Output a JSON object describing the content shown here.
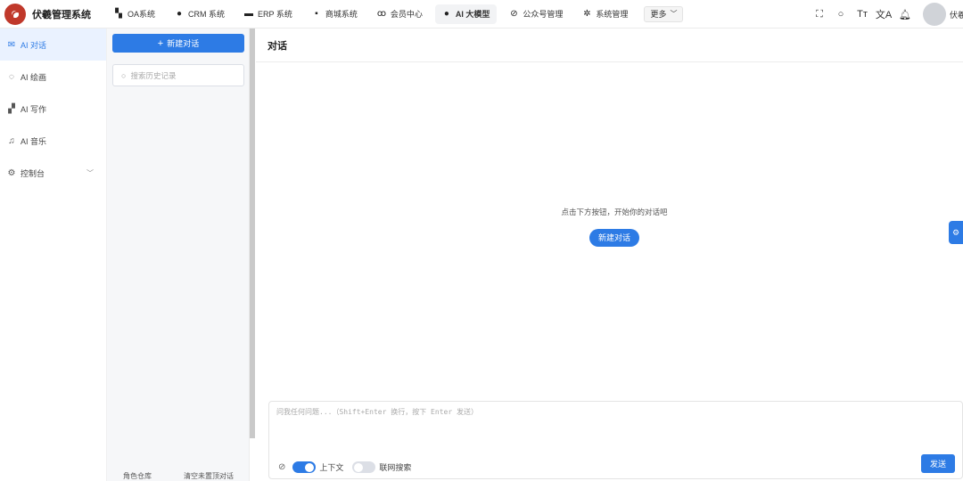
{
  "app": {
    "title": "伏羲管理系统"
  },
  "nav": {
    "items": [
      {
        "label": "OA系统",
        "icon": "oa-icon",
        "glyph": "▚"
      },
      {
        "label": "CRM 系统",
        "icon": "user-icon",
        "glyph": "●"
      },
      {
        "label": "ERP 系统",
        "icon": "erp-icon",
        "glyph": "▬"
      },
      {
        "label": "商城系统",
        "icon": "shop-icon",
        "glyph": "▪"
      },
      {
        "label": "会员中心",
        "icon": "bike-icon",
        "glyph": "ꝏ"
      },
      {
        "label": "AI 大模型",
        "icon": "apple-icon",
        "glyph": "●"
      },
      {
        "label": "公众号管理",
        "icon": "compass-icon",
        "glyph": "⊘"
      },
      {
        "label": "系统管理",
        "icon": "gear-icon",
        "glyph": "✲"
      }
    ],
    "active_index": 5,
    "more_label": "更多"
  },
  "header_tools": {
    "fullscreen": "⛶",
    "search": "○",
    "font_size": "Tт",
    "translate": "文A",
    "bell": "♫",
    "username": "伏羲"
  },
  "sidebar": {
    "items": [
      {
        "label": "AI 对话",
        "icon": "mail-icon",
        "glyph": "✉",
        "active": true
      },
      {
        "label": "AI 绘画",
        "icon": "palette-icon",
        "glyph": "◌"
      },
      {
        "label": "AI 写作",
        "icon": "writing-icon",
        "glyph": "▞"
      },
      {
        "label": "AI 音乐",
        "icon": "music-icon",
        "glyph": "♫"
      },
      {
        "label": "控制台",
        "icon": "settings-icon",
        "glyph": "⚙",
        "has_children": true
      }
    ]
  },
  "history": {
    "new_chat_label": "新建对话",
    "search_placeholder": "搜索历史记录",
    "footer_left": "角色仓库",
    "footer_right": "清空未置顶对话"
  },
  "main": {
    "title": "对话",
    "empty_hint": "点击下方按钮，开始你的对话吧",
    "empty_button": "新建对话",
    "input_placeholder": "问我任何问题...（Shift+Enter 换行，按下 Enter 发送）",
    "context_label": "上下文",
    "context_on": true,
    "web_search_label": "联网搜索",
    "web_search_on": false,
    "send_label": "发送"
  },
  "colors": {
    "primary": "#2d7be5",
    "active_bg": "#eaf2ff"
  }
}
